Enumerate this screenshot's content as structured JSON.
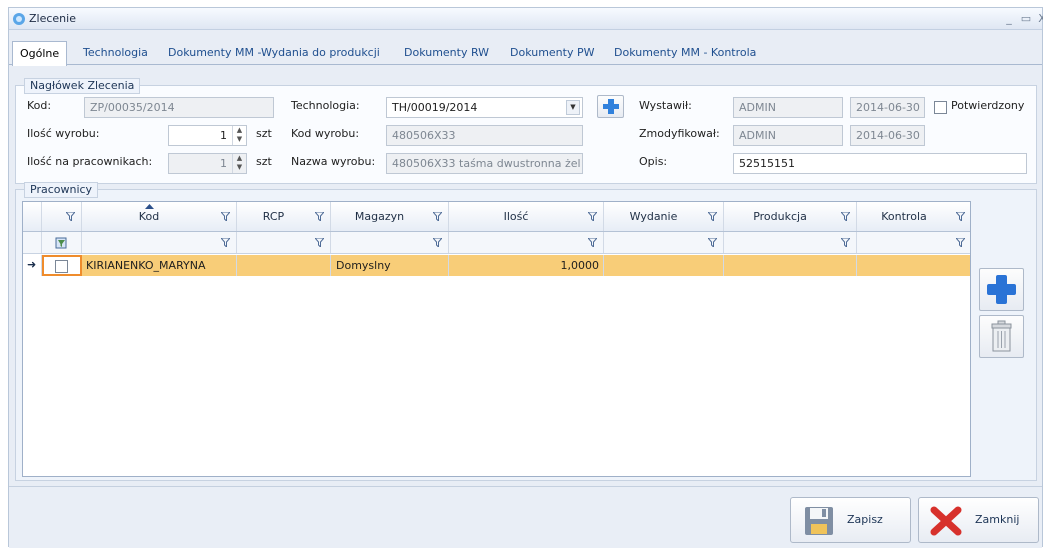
{
  "window": {
    "title": "Zlecenie",
    "minimize": "_",
    "maximize": "▭",
    "close": "X"
  },
  "tabs": [
    {
      "label": "Ogólne"
    },
    {
      "label": "Technologia"
    },
    {
      "label": "Dokumenty MM -Wydania do produkcji"
    },
    {
      "label": "Dokumenty RW"
    },
    {
      "label": "Dokumenty PW"
    },
    {
      "label": "Dokumenty MM - Kontrola"
    }
  ],
  "header": {
    "title": "Nagłówek Zlecenia",
    "kod_label": "Kod:",
    "kod_value": "ZP/00035/2014",
    "ilosc_label": "Ilość wyrobu:",
    "ilosc_value": "1",
    "ilosc_unit": "szt",
    "ilosc_prac_label": "Ilość na pracownikach:",
    "ilosc_prac_value": "1",
    "ilosc_prac_unit": "szt",
    "technologia_label": "Technologia:",
    "technologia_value": "TH/00019/2014",
    "kod_wyrobu_label": "Kod wyrobu:",
    "kod_wyrobu_value": "480506X33",
    "nazwa_wyrobu_label": "Nazwa wyrobu:",
    "nazwa_wyrobu_value": "480506X33 taśma dwustronna żel",
    "wystawil_label": "Wystawił:",
    "wystawil_value": "ADMIN",
    "wystawil_date": "2014-06-30",
    "zmodyfikowal_label": "Zmodyfikował:",
    "zmodyfikowal_value": "ADMIN",
    "zmodyfikowal_date": "2014-06-30",
    "opis_label": "Opis:",
    "opis_value": "52515151",
    "potwierdzony_label": "Potwierdzony"
  },
  "workers": {
    "title": "Pracownicy",
    "columns": [
      "Kod",
      "RCP",
      "Magazyn",
      "Ilość",
      "Wydanie",
      "Produkcja",
      "Kontrola"
    ],
    "rows": [
      {
        "indicator": "➜",
        "kod": "KIRIANENKO_MARYNA",
        "rcp": "",
        "magazyn": "Domyslny",
        "ilosc": "1,0000",
        "wydanie": "",
        "produkcja": "",
        "kontrola": ""
      }
    ]
  },
  "footer": {
    "save_label": "Zapisz",
    "close_label": "Zamknij"
  },
  "colors": {
    "selected_row": "#f8cd78",
    "accent": "#2a73d6",
    "delete_red": "#d7312c"
  },
  "icons": {
    "add": "plus-icon",
    "delete": "trash-icon",
    "save": "floppy-disk-icon",
    "close": "red-x-icon",
    "filter": "filter-icon"
  }
}
